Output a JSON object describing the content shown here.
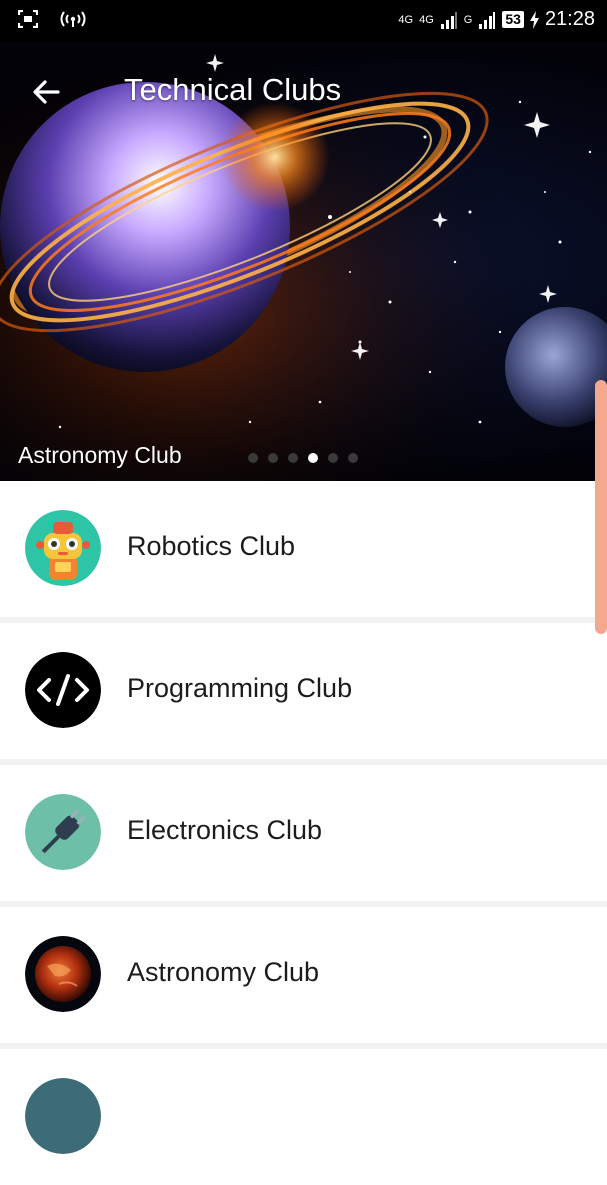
{
  "status_bar": {
    "network_top": "4G",
    "network_1": "4G",
    "network_2": "G",
    "battery": "53",
    "time": "21:28"
  },
  "header": {
    "title": "Technical Clubs"
  },
  "banner": {
    "caption": "Astronomy Club",
    "slide_count": 6,
    "active_slide": 4
  },
  "clubs": [
    {
      "label": "Robotics Club",
      "icon": "robot-icon"
    },
    {
      "label": "Programming Club",
      "icon": "code-icon"
    },
    {
      "label": "Electronics Club",
      "icon": "plug-icon"
    },
    {
      "label": "Astronomy Club",
      "icon": "planet-icon"
    }
  ],
  "colors": {
    "accent": "#f4a98e",
    "robot_bg": "#2ec4a6",
    "code_bg": "#000000",
    "plug_bg": "#6dbfa8",
    "text": "#1c1c1c"
  }
}
